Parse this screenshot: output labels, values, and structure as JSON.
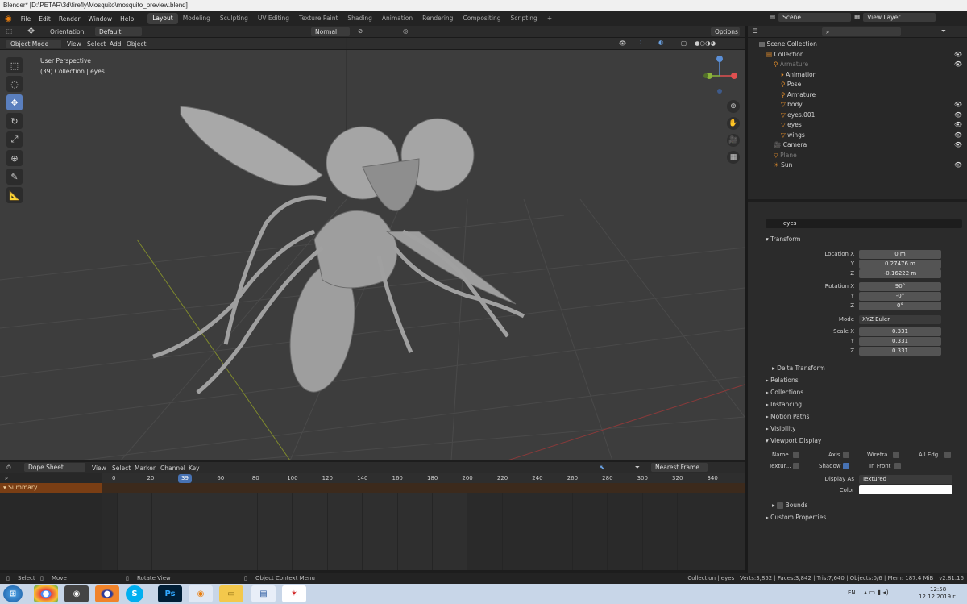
{
  "window": {
    "title": "Blender* [D:\\PETAR\\3d\\firefly\\Mosquito\\mosquito_preview.blend]"
  },
  "menu": {
    "items": [
      "File",
      "Edit",
      "Render",
      "Window",
      "Help"
    ]
  },
  "workspaces": [
    "Layout",
    "Modeling",
    "Sculpting",
    "UV Editing",
    "Texture Paint",
    "Shading",
    "Animation",
    "Rendering",
    "Compositing",
    "Scripting"
  ],
  "scene": {
    "name": "Scene",
    "view_layer": "View Layer"
  },
  "header": {
    "orientation_label": "Orientation:",
    "orientation": "Default",
    "pivot": "Normal",
    "options": "Options"
  },
  "viewport_menu": {
    "mode": "Object Mode",
    "items": [
      "View",
      "Select",
      "Add",
      "Object"
    ]
  },
  "viewport": {
    "perspective": "User Perspective",
    "context": "(39) Collection | eyes"
  },
  "outliner": {
    "root": "Scene Collection",
    "rows": [
      {
        "label": "Collection",
        "indent": 1,
        "eye": true
      },
      {
        "label": "Armature",
        "indent": 2,
        "eye": true,
        "dim": true
      },
      {
        "label": "Animation",
        "indent": 3,
        "eye": false
      },
      {
        "label": "Pose",
        "indent": 3,
        "eye": false
      },
      {
        "label": "Armature",
        "indent": 3,
        "eye": false
      },
      {
        "label": "body",
        "indent": 3,
        "eye": true
      },
      {
        "label": "eyes.001",
        "indent": 3,
        "eye": true
      },
      {
        "label": "eyes",
        "indent": 3,
        "eye": true
      },
      {
        "label": "wings",
        "indent": 3,
        "eye": true
      },
      {
        "label": "Camera",
        "indent": 2,
        "eye": true
      },
      {
        "label": "Plane",
        "indent": 2,
        "eye": false,
        "dim": true
      },
      {
        "label": "Sun",
        "indent": 2,
        "eye": true
      }
    ]
  },
  "properties": {
    "object_name": "eyes",
    "field_name": "eyes",
    "transform_label": "Transform",
    "location_x_label": "Location X",
    "location_x": "0 m",
    "location_y_label": "Y",
    "location_y": "0.27476 m",
    "location_z_label": "Z",
    "location_z": "-0.16222 m",
    "rotation_x_label": "Rotation X",
    "rotation_x": "90°",
    "rotation_y_label": "Y",
    "rotation_y": "-0°",
    "rotation_z_label": "Z",
    "rotation_z": "0°",
    "mode_label": "Mode",
    "mode": "XYZ Euler",
    "scale_x_label": "Scale X",
    "scale_x": "0.331",
    "scale_y_label": "Y",
    "scale_y": "0.331",
    "scale_z_label": "Z",
    "scale_z": "0.331",
    "sections": [
      "Delta Transform",
      "Relations",
      "Collections",
      "Instancing",
      "Motion Paths",
      "Visibility",
      "Viewport Display"
    ],
    "vd": {
      "name": "Name",
      "axis": "Axis",
      "wireframe": "Wirefra...",
      "all_edges": "All Edg...",
      "texture": "Textur...",
      "shadow": "Shadow",
      "in_front": "In Front",
      "display_as_label": "Display As",
      "display_as": "Textured",
      "color_label": "Color",
      "bounds": "Bounds"
    },
    "custom": "Custom Properties"
  },
  "dopesheet": {
    "mode": "Dope Sheet",
    "menu": [
      "View",
      "Select",
      "Marker",
      "Channel",
      "Key"
    ],
    "snap": "Nearest Frame",
    "summary": "Summary",
    "current_frame": "39",
    "ticks": [
      "0",
      "20",
      "60",
      "80",
      "100",
      "120",
      "140",
      "160",
      "180",
      "200",
      "220",
      "240",
      "260",
      "280",
      "300",
      "320",
      "340"
    ]
  },
  "status": {
    "select": "Select",
    "move": "Move",
    "rotate": "Rotate View",
    "context_menu": "Object Context Menu",
    "info": "Collection | eyes | Verts:3,852 | Faces:3,842 | Tris:7,640 | Objects:0/6 | Mem: 187.4 MiB | v2.81.16"
  },
  "taskbar": {
    "lang": "EN",
    "time": "12:58",
    "date": "12.12.2019 г."
  },
  "colors": {
    "accent": "#4772b3",
    "viewport_bg": "#3d3d3d",
    "selected_orange": "#e8902b"
  }
}
